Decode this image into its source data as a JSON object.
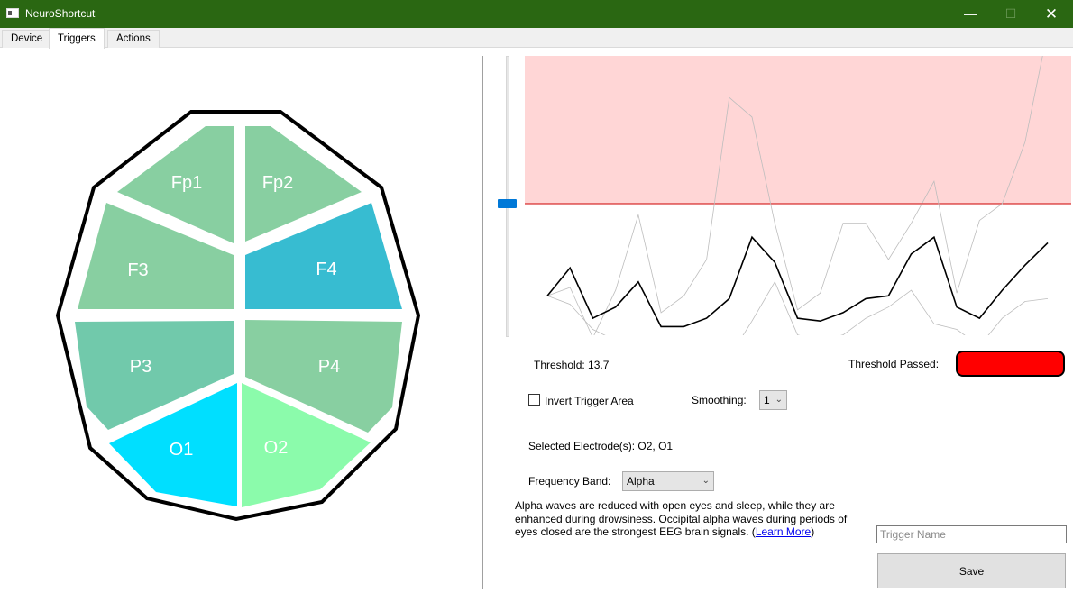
{
  "window": {
    "title": "NeuroShortcut",
    "minimize_glyph": "—",
    "maximize_glyph": "☐",
    "close_glyph": "✕"
  },
  "tabs": [
    {
      "label": "Device",
      "active": false
    },
    {
      "label": "Triggers",
      "active": true
    },
    {
      "label": "Actions",
      "active": false
    }
  ],
  "electrodes": [
    {
      "label": "Fp1",
      "color": "#88cfa1",
      "selected": false
    },
    {
      "label": "Fp2",
      "color": "#88cfa1",
      "selected": false
    },
    {
      "label": "F3",
      "color": "#88cfa1",
      "selected": false
    },
    {
      "label": "F4",
      "color": "#37bcd1",
      "selected": false
    },
    {
      "label": "P3",
      "color": "#71c9ab",
      "selected": false
    },
    {
      "label": "P4",
      "color": "#88cfa1",
      "selected": false
    },
    {
      "label": "O1",
      "color": "#00dfff",
      "selected": true
    },
    {
      "label": "O2",
      "color": "#8bfbab",
      "selected": true
    }
  ],
  "threshold": {
    "label": "Threshold: 13.7",
    "value": 13.7,
    "slider_fraction": 0.53,
    "passed_label": "Threshold Passed:",
    "passed_color": "#ff0000",
    "area_color": "#ffd6d6",
    "line_color": "#cc0000"
  },
  "chart_data": {
    "type": "line",
    "series": [
      {
        "role": "primary",
        "color": "#000000",
        "values": [
          0.33,
          0.23,
          0.41,
          0.37,
          0.28,
          0.44,
          0.44,
          0.41,
          0.34,
          0.12,
          0.21,
          0.41,
          0.42,
          0.39,
          0.34,
          0.33,
          0.18,
          0.12,
          0.37,
          0.41,
          0.31,
          0.22,
          0.14
        ]
      },
      {
        "role": "upper-envelope",
        "color": "#bdbdbd",
        "values": [
          0.33,
          0.3,
          0.48,
          0.31,
          0.04,
          0.39,
          0.33,
          0.2,
          -0.38,
          -0.31,
          0.07,
          0.38,
          0.32,
          0.07,
          0.07,
          0.2,
          0.07,
          -0.08,
          0.32,
          0.06,
          0.0,
          -0.22,
          -0.62
        ]
      },
      {
        "role": "lower-envelope",
        "color": "#bdbdbd",
        "values": [
          0.33,
          0.36,
          0.45,
          0.49,
          0.49,
          0.53,
          0.52,
          0.53,
          0.55,
          0.42,
          0.28,
          0.47,
          0.49,
          0.47,
          0.41,
          0.37,
          0.31,
          0.43,
          0.45,
          0.51,
          0.41,
          0.35,
          0.34
        ]
      }
    ]
  },
  "controls": {
    "invert_label": "Invert Trigger Area",
    "invert_checked": false,
    "smoothing_label": "Smoothing:",
    "smoothing_value": "1",
    "selected_electrodes": "Selected Electrode(s): O2, O1",
    "band_label": "Frequency Band:",
    "band_value": "Alpha",
    "chevron_glyph": "⌄"
  },
  "description": {
    "text": "Alpha waves are reduced with open eyes and sleep, while they are enhanced during drowsiness. Occipital alpha waves during periods of eyes closed are the strongest EEG brain signals. (",
    "link": "Learn More",
    "suffix": ")"
  },
  "trigger": {
    "placeholder": "Trigger Name",
    "save_label": "Save"
  }
}
